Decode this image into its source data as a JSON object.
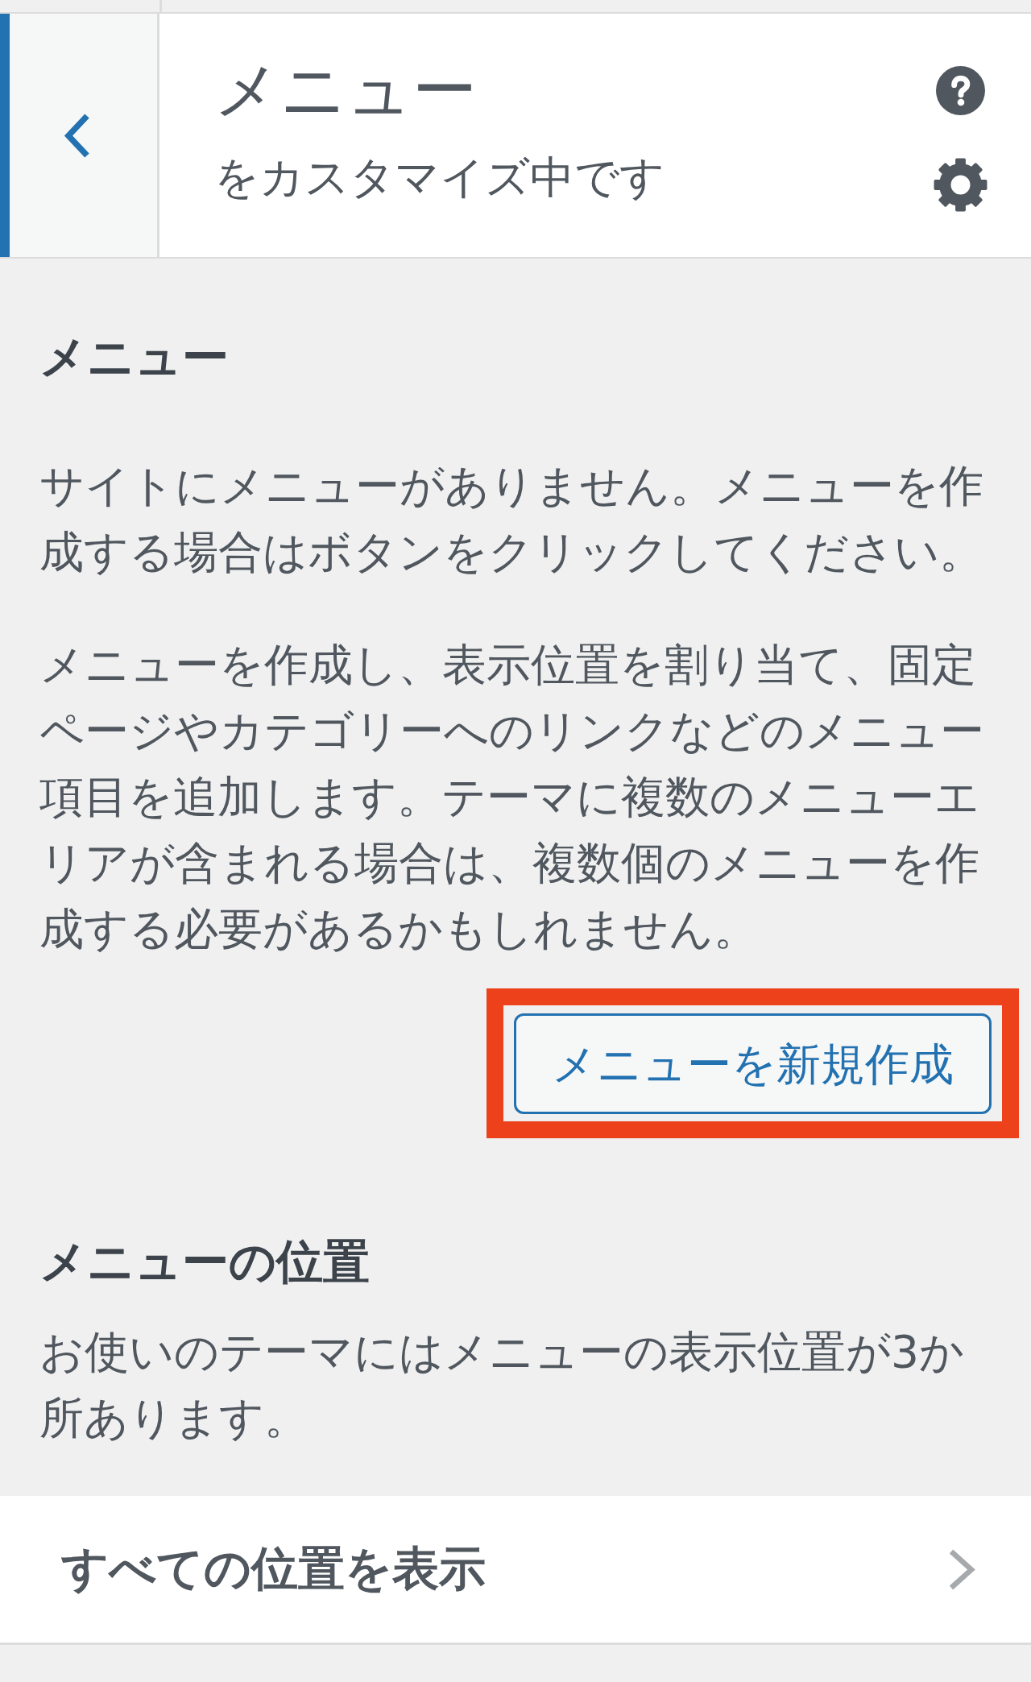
{
  "header": {
    "title": "メニュー",
    "subtitle": "をカスタマイズ中です"
  },
  "menus_section": {
    "heading": "メニュー",
    "paragraphs": [
      "サイトにメニューがありません。メニューを作成する場合はボタンをクリックしてください。",
      "メニューを作成し、表示位置を割り当て、固定ページやカテゴリーへのリンクなどのメニュー項目を追加します。テーマに複数のメニューエリアが含まれる場合は、複数個のメニューを作成する必要があるかもしれません。"
    ],
    "button": {
      "label": "メニューを新規作成",
      "highlighted": true
    }
  },
  "locations_section": {
    "heading": "メニューの位置",
    "paragraphs": [
      "お使いのテーマにはメニューの表示位置が3か所あります。"
    ]
  },
  "locations_link": {
    "label": "すべての位置を表示"
  }
}
